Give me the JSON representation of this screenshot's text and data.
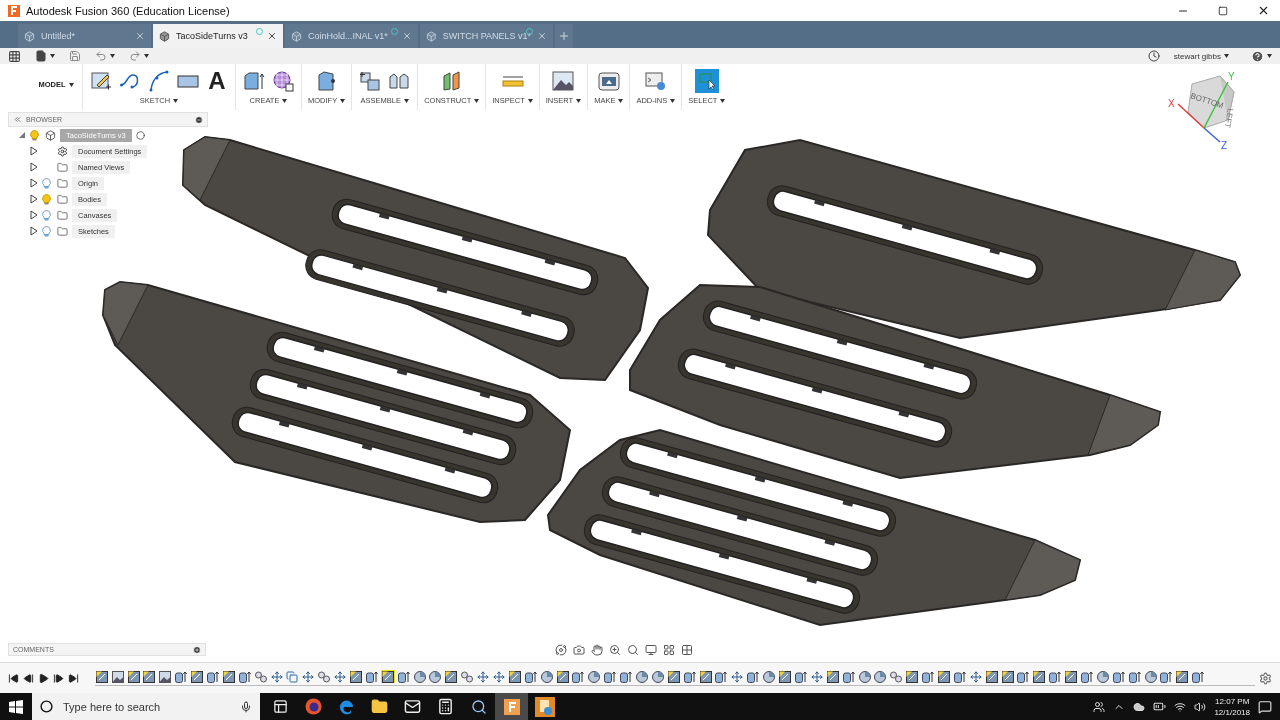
{
  "window": {
    "title": "Autodesk Fusion 360 (Education License)"
  },
  "tabs": [
    {
      "label": "Untitled*",
      "selected": false,
      "sync_marker": false
    },
    {
      "label": "TacoSideTurns v3",
      "selected": true,
      "sync_marker": true
    },
    {
      "label": "CoinHold...INAL v1*",
      "selected": false,
      "sync_marker": true
    },
    {
      "label": "SWITCH PANELS v1*",
      "selected": false,
      "sync_marker": true
    }
  ],
  "account": {
    "user": "stewart gibbs"
  },
  "ribbon": {
    "workspace": "MODEL",
    "groups": [
      {
        "label": "SKETCH",
        "selected": false,
        "tools": [
          {
            "kind": "create-sketch"
          },
          {
            "kind": "spline"
          },
          {
            "kind": "arc"
          },
          {
            "kind": "rectangle"
          },
          {
            "kind": "text",
            "glyph": "A"
          }
        ]
      },
      {
        "label": "CREATE",
        "selected": false,
        "tools": [
          {
            "kind": "extrude"
          },
          {
            "kind": "form"
          }
        ]
      },
      {
        "label": "MODIFY",
        "selected": false,
        "tools": [
          {
            "kind": "press-pull"
          }
        ]
      },
      {
        "label": "ASSEMBLE",
        "selected": false,
        "tools": [
          {
            "kind": "component"
          },
          {
            "kind": "joint"
          }
        ]
      },
      {
        "label": "CONSTRUCT",
        "selected": false,
        "tools": [
          {
            "kind": "plane"
          }
        ]
      },
      {
        "label": "INSPECT",
        "selected": false,
        "tools": [
          {
            "kind": "measure"
          }
        ]
      },
      {
        "label": "INSERT",
        "selected": false,
        "tools": [
          {
            "kind": "image"
          }
        ]
      },
      {
        "label": "MAKE",
        "selected": false,
        "tools": [
          {
            "kind": "printer"
          }
        ]
      },
      {
        "label": "ADD-INS",
        "selected": false,
        "tools": [
          {
            "kind": "scripts"
          }
        ]
      },
      {
        "label": "SELECT",
        "selected": true,
        "tools": [
          {
            "kind": "select"
          }
        ]
      }
    ]
  },
  "browser": {
    "title": "BROWSER",
    "root": {
      "label": "TacoSideTurns v3",
      "kind": "component",
      "has_bulb": true,
      "visible": true,
      "expanded": true,
      "selected": true,
      "children": [
        {
          "label": "Document Settings",
          "kind": "gear",
          "has_bulb": false,
          "expanded": false,
          "selected": false
        },
        {
          "label": "Named Views",
          "kind": "folder",
          "has_bulb": false,
          "expanded": false,
          "selected": false
        },
        {
          "label": "Origin",
          "kind": "folder",
          "has_bulb": true,
          "visible": false,
          "expanded": false,
          "selected": false
        },
        {
          "label": "Bodies",
          "kind": "folder",
          "has_bulb": true,
          "visible": true,
          "expanded": false,
          "selected": false
        },
        {
          "label": "Canvases",
          "kind": "folder",
          "has_bulb": true,
          "visible": false,
          "expanded": false,
          "selected": false
        },
        {
          "label": "Sketches",
          "kind": "folder",
          "has_bulb": true,
          "visible": false,
          "expanded": false,
          "selected": false
        }
      ]
    }
  },
  "viewcube": {
    "face": "BOTTOM",
    "side": "LEFT",
    "axes": [
      "X",
      "Y",
      "Z"
    ]
  },
  "comments": {
    "title": "COMMENTS"
  },
  "timeline": {
    "features": [
      {
        "kind": "sketch",
        "selected": false
      },
      {
        "kind": "canvas",
        "selected": false
      },
      {
        "kind": "sketch",
        "selected": false
      },
      {
        "kind": "sketch",
        "selected": false
      },
      {
        "kind": "canvas",
        "selected": false
      },
      {
        "kind": "extrude",
        "selected": false
      },
      {
        "kind": "sketch",
        "selected": false
      },
      {
        "kind": "extrude",
        "selected": false
      },
      {
        "kind": "sketch",
        "selected": false
      },
      {
        "kind": "extrude",
        "selected": false
      },
      {
        "kind": "joint",
        "selected": false
      },
      {
        "kind": "move",
        "selected": false
      },
      {
        "kind": "copy",
        "selected": false
      },
      {
        "kind": "move",
        "selected": false
      },
      {
        "kind": "joint",
        "selected": false
      },
      {
        "kind": "move",
        "selected": false
      },
      {
        "kind": "sketch",
        "selected": false
      },
      {
        "kind": "extrude",
        "selected": false
      },
      {
        "kind": "sketch",
        "selected": true
      },
      {
        "kind": "extrude",
        "selected": false
      },
      {
        "kind": "fillet",
        "selected": false
      },
      {
        "kind": "fillet",
        "selected": false
      },
      {
        "kind": "sketch",
        "selected": false
      },
      {
        "kind": "joint",
        "selected": false
      },
      {
        "kind": "move",
        "selected": false
      },
      {
        "kind": "move",
        "selected": false
      },
      {
        "kind": "sketch",
        "selected": false
      },
      {
        "kind": "extrude",
        "selected": false
      },
      {
        "kind": "fillet",
        "selected": false
      },
      {
        "kind": "sketch",
        "selected": false
      },
      {
        "kind": "extrude",
        "selected": false
      },
      {
        "kind": "fillet",
        "selected": false
      },
      {
        "kind": "extrude",
        "selected": false
      },
      {
        "kind": "extrude",
        "selected": false
      },
      {
        "kind": "fillet",
        "selected": false
      },
      {
        "kind": "fillet",
        "selected": false
      },
      {
        "kind": "sketch",
        "selected": false
      },
      {
        "kind": "extrude",
        "selected": false
      },
      {
        "kind": "sketch",
        "selected": false
      },
      {
        "kind": "extrude",
        "selected": false
      },
      {
        "kind": "move",
        "selected": false
      },
      {
        "kind": "extrude",
        "selected": false
      },
      {
        "kind": "fillet",
        "selected": false
      },
      {
        "kind": "sketch",
        "selected": false
      },
      {
        "kind": "extrude",
        "selected": false
      },
      {
        "kind": "move",
        "selected": false
      },
      {
        "kind": "sketch",
        "selected": false
      },
      {
        "kind": "extrude",
        "selected": false
      },
      {
        "kind": "fillet",
        "selected": false
      },
      {
        "kind": "fillet",
        "selected": false
      },
      {
        "kind": "joint",
        "selected": false
      },
      {
        "kind": "sketch",
        "selected": false
      },
      {
        "kind": "extrude",
        "selected": false
      },
      {
        "kind": "sketch",
        "selected": false
      },
      {
        "kind": "extrude",
        "selected": false
      },
      {
        "kind": "move",
        "selected": false
      },
      {
        "kind": "sketch",
        "selected": false
      },
      {
        "kind": "sketch",
        "selected": false
      },
      {
        "kind": "extrude",
        "selected": false
      },
      {
        "kind": "sketch",
        "selected": false
      },
      {
        "kind": "extrude",
        "selected": false
      },
      {
        "kind": "sketch",
        "selected": false
      },
      {
        "kind": "extrude",
        "selected": false
      },
      {
        "kind": "fillet",
        "selected": false
      },
      {
        "kind": "extrude",
        "selected": false
      },
      {
        "kind": "extrude",
        "selected": false
      },
      {
        "kind": "fillet",
        "selected": false
      },
      {
        "kind": "extrude",
        "selected": false
      },
      {
        "kind": "sketch",
        "selected": false
      },
      {
        "kind": "extrude",
        "selected": false
      }
    ]
  },
  "taskbar": {
    "search_placeholder": "Type here to search",
    "apps": [
      {
        "kind": "task-view",
        "selected": false
      },
      {
        "kind": "firefox",
        "selected": false
      },
      {
        "kind": "edge",
        "selected": false
      },
      {
        "kind": "explorer",
        "selected": false
      },
      {
        "kind": "mail",
        "selected": false
      },
      {
        "kind": "calculator",
        "selected": false
      },
      {
        "kind": "magnifier",
        "selected": false
      },
      {
        "kind": "fusion",
        "selected": true
      },
      {
        "kind": "fusion-alt",
        "selected": false
      }
    ],
    "time": "12:07 PM",
    "date": "12/1/2018"
  }
}
